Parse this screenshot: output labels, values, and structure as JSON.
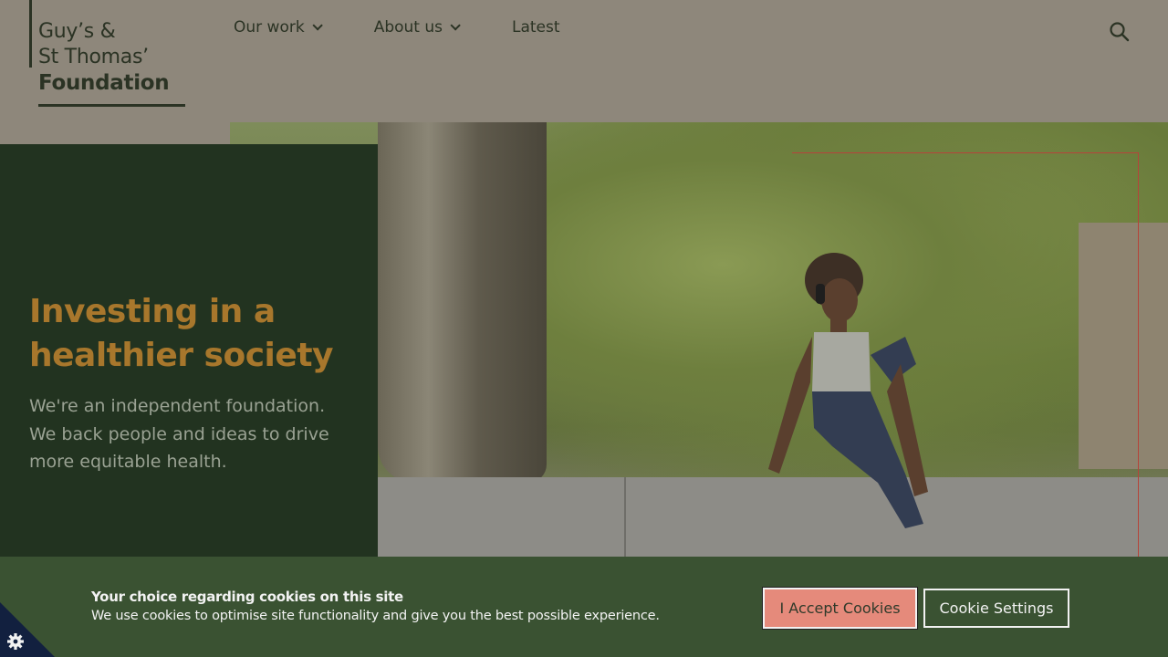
{
  "header": {
    "logo": {
      "line1": "Guy’s &",
      "line2": "St Thomas’",
      "line3": "Foundation"
    },
    "nav": [
      {
        "label": "Our work",
        "has_dropdown": true
      },
      {
        "label": "About us",
        "has_dropdown": true
      },
      {
        "label": "Latest",
        "has_dropdown": false
      }
    ],
    "search_icon": "search-icon"
  },
  "hero": {
    "title": "Investing in a healthier society",
    "text": "We're an independent foundation. We back people and ideas to drive more equitable health."
  },
  "cookie_banner": {
    "title": "Your choice regarding cookies on this site",
    "text": "We use cookies to optimise site functionality and give you the best possible experience.",
    "accept_label": "I Accept Cookies",
    "settings_label": "Cookie Settings",
    "corner_icon": "gear-icon"
  },
  "colors": {
    "header_bg": "#8e877b",
    "brand_dark": "#223320",
    "hero_title": "#a8772c",
    "banner_bg": "#3a5232",
    "accept_btn": "#e58a7b"
  }
}
